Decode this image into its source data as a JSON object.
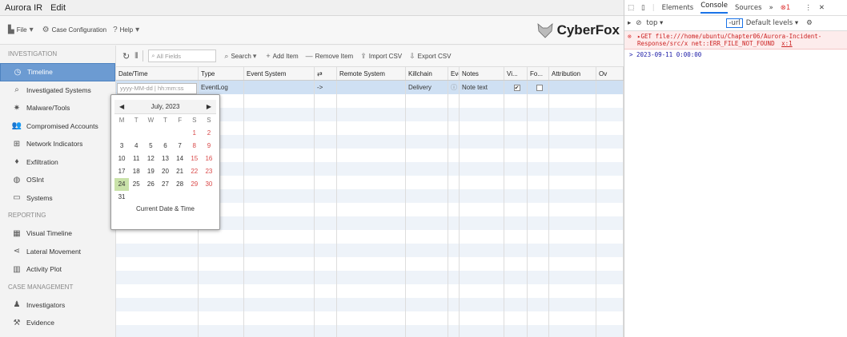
{
  "window": {
    "menu": [
      "Aurora IR",
      "Edit"
    ]
  },
  "toolbar": {
    "file": "File",
    "case_config": "Case Configuration",
    "help": "Help"
  },
  "brand": "CyberFox",
  "sidebar": {
    "sections": [
      {
        "title": "INVESTIGATION",
        "items": [
          {
            "label": "Timeline",
            "icon": "clock-icon",
            "glyph": "◷"
          },
          {
            "label": "Investigated Systems",
            "icon": "search-system-icon",
            "glyph": "⌕"
          },
          {
            "label": "Malware/Tools",
            "icon": "bug-icon",
            "glyph": "✷"
          },
          {
            "label": "Compromised Accounts",
            "icon": "users-icon",
            "glyph": "👥"
          },
          {
            "label": "Network Indicators",
            "icon": "network-icon",
            "glyph": "⊞"
          },
          {
            "label": "Exfiltration",
            "icon": "fire-icon",
            "glyph": "♦"
          },
          {
            "label": "OSInt",
            "icon": "globe-icon",
            "glyph": "◍"
          },
          {
            "label": "Systems",
            "icon": "monitor-icon",
            "glyph": "▭"
          }
        ]
      },
      {
        "title": "REPORTING",
        "items": [
          {
            "label": "Visual Timeline",
            "icon": "calendar-icon",
            "glyph": "▦"
          },
          {
            "label": "Lateral Movement",
            "icon": "share-icon",
            "glyph": "⋖"
          },
          {
            "label": "Activity Plot",
            "icon": "bar-chart-icon",
            "glyph": "▥"
          }
        ]
      },
      {
        "title": "CASE MANAGEMENT",
        "items": [
          {
            "label": "Investigators",
            "icon": "user-icon",
            "glyph": "♟"
          },
          {
            "label": "Evidence",
            "icon": "gavel-icon",
            "glyph": "⚒"
          }
        ]
      }
    ]
  },
  "gridtool": {
    "search_placeholder": "All Fields",
    "search": "Search",
    "add_item": "Add Item",
    "remove_item": "Remove Item",
    "import_csv": "Import CSV",
    "export_csv": "Export CSV"
  },
  "table": {
    "columns": [
      "Date/Time",
      "Type",
      "Event System",
      "⇄",
      "Remote System",
      "Killchain",
      "Eve",
      "Notes",
      "Vi...",
      "Fo...",
      "Attribution",
      "Ov"
    ],
    "selected_row": {
      "date_placeholder": "yyyy-MM-dd | hh:mm:ss",
      "type": "EventLog",
      "direction": "->",
      "killchain": "Delivery",
      "notes": "Note text"
    }
  },
  "datepicker": {
    "month": "July, 2023",
    "weekdays": [
      "M",
      "T",
      "W",
      "T",
      "F",
      "S",
      "S"
    ],
    "weeks": [
      [
        "",
        "",
        "",
        "",
        "",
        "1",
        "2"
      ],
      [
        "3",
        "4",
        "5",
        "6",
        "7",
        "8",
        "9"
      ],
      [
        "10",
        "11",
        "12",
        "13",
        "14",
        "15",
        "16"
      ],
      [
        "17",
        "18",
        "19",
        "20",
        "21",
        "22",
        "23"
      ],
      [
        "24",
        "25",
        "26",
        "27",
        "28",
        "29",
        "30"
      ],
      [
        "31",
        "",
        "",
        "",
        "",
        "",
        ""
      ]
    ],
    "today": "24",
    "footer": "Current Date & Time"
  },
  "devtools": {
    "tabs": [
      "Elements",
      "Console",
      "Sources"
    ],
    "active_tab": "Console",
    "more": "»",
    "error_count": "1",
    "context": "top",
    "filter_value": "-url",
    "levels": "Default levels",
    "error_msg": "▸GET file:///home/ubuntu/Chapter06/Aurora-Incident-Response/src/x net::ERR_FILE_NOT_FOUND",
    "error_source": "x:1",
    "log_output": "> 2023-09-11 0:00:00"
  }
}
